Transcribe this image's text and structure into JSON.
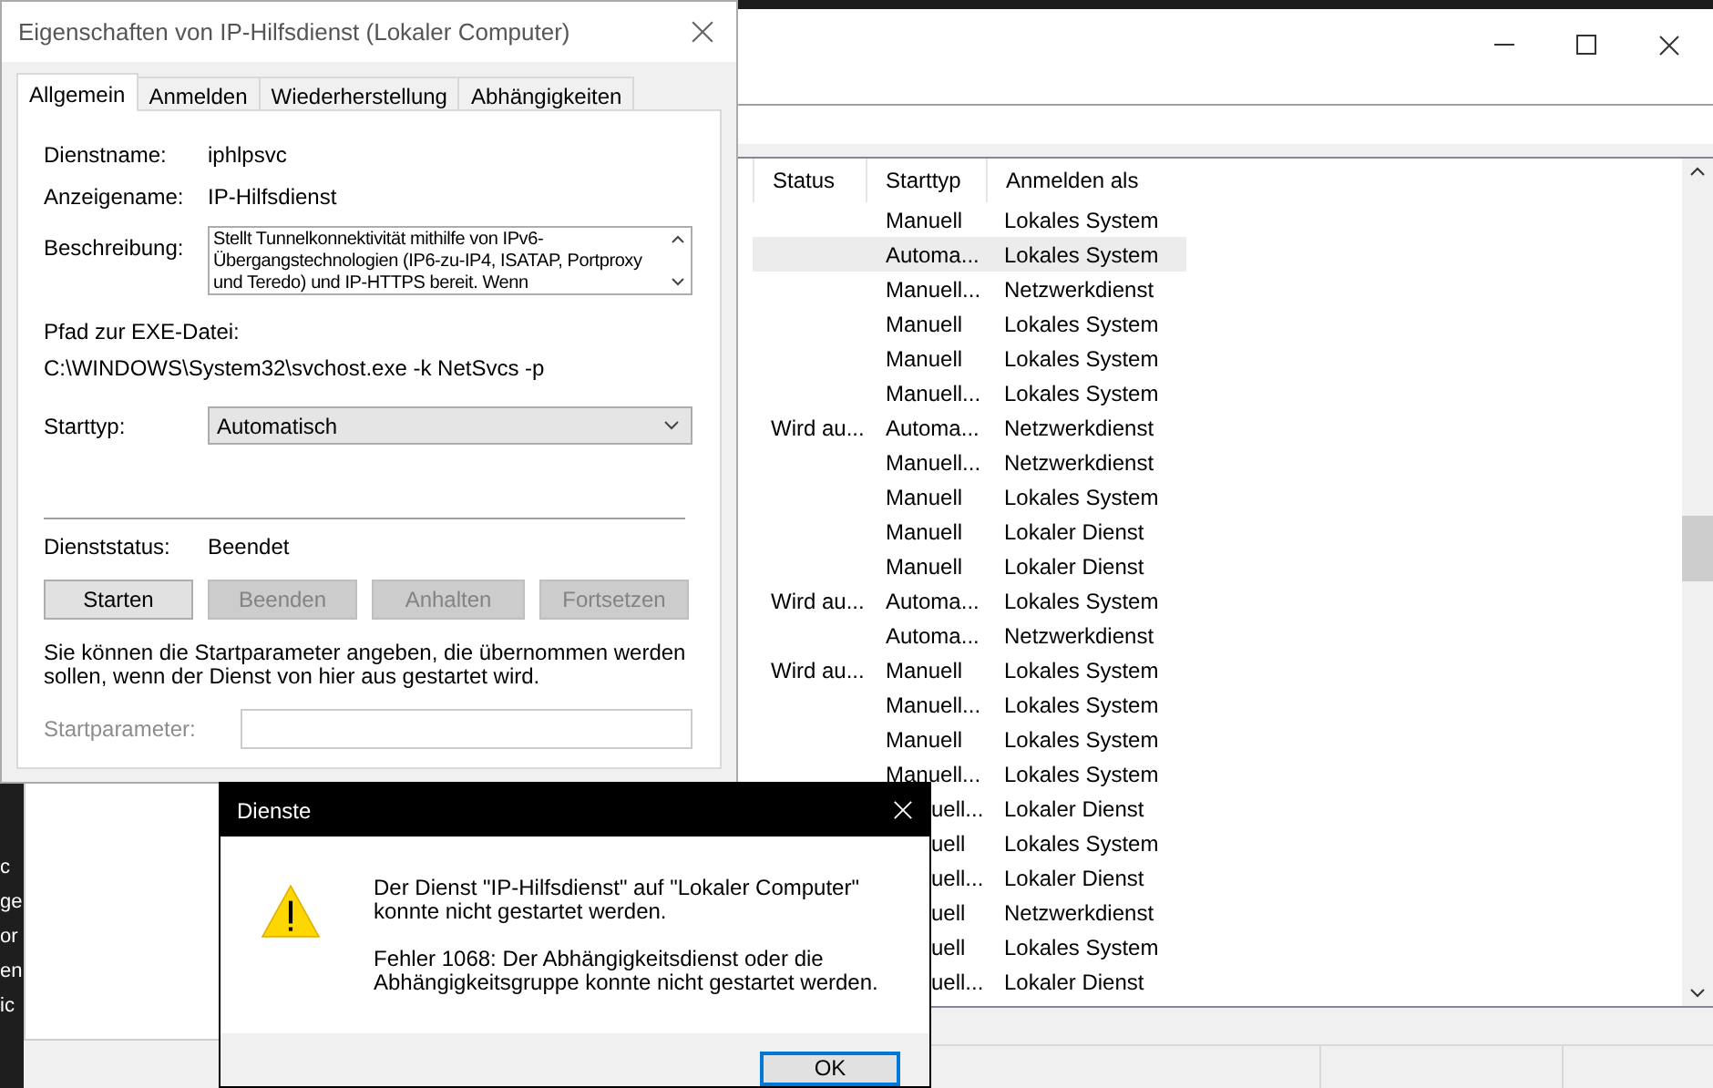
{
  "background_text": [
    "c",
    "ge",
    "or",
    "en",
    "ic"
  ],
  "services_window": {
    "columns": [
      "Status",
      "Starttyp",
      "Anmelden als"
    ],
    "rows": [
      {
        "status": "",
        "starttyp": "Manuell",
        "anmelden_als": "Lokales System",
        "selected": false
      },
      {
        "status": "",
        "starttyp": "Automa...",
        "anmelden_als": "Lokales System",
        "selected": true
      },
      {
        "status": "",
        "starttyp": "Manuell...",
        "anmelden_als": "Netzwerkdienst",
        "selected": false
      },
      {
        "status": "",
        "starttyp": "Manuell",
        "anmelden_als": "Lokales System",
        "selected": false
      },
      {
        "status": "",
        "starttyp": "Manuell",
        "anmelden_als": "Lokales System",
        "selected": false
      },
      {
        "status": "",
        "starttyp": "Manuell...",
        "anmelden_als": "Lokales System",
        "selected": false
      },
      {
        "status": "Wird au...",
        "starttyp": "Automa...",
        "anmelden_als": "Netzwerkdienst",
        "selected": false
      },
      {
        "status": "",
        "starttyp": "Manuell...",
        "anmelden_als": "Netzwerkdienst",
        "selected": false
      },
      {
        "status": "",
        "starttyp": "Manuell",
        "anmelden_als": "Lokales System",
        "selected": false
      },
      {
        "status": "",
        "starttyp": "Manuell",
        "anmelden_als": "Lokaler Dienst",
        "selected": false
      },
      {
        "status": "",
        "starttyp": "Manuell",
        "anmelden_als": "Lokaler Dienst",
        "selected": false
      },
      {
        "status": "Wird au...",
        "starttyp": "Automa...",
        "anmelden_als": "Lokales System",
        "selected": false
      },
      {
        "status": "",
        "starttyp": "Automa...",
        "anmelden_als": "Netzwerkdienst",
        "selected": false
      },
      {
        "status": "Wird au...",
        "starttyp": "Manuell",
        "anmelden_als": "Lokales System",
        "selected": false
      },
      {
        "status": "",
        "starttyp": "Manuell...",
        "anmelden_als": "Lokales System",
        "selected": false
      },
      {
        "status": "",
        "starttyp": "Manuell",
        "anmelden_als": "Lokales System",
        "selected": false
      },
      {
        "status": "",
        "starttyp": "Manuell...",
        "anmelden_als": "Lokales System",
        "selected": false
      },
      {
        "status": "",
        "starttyp": "uell...",
        "anmelden_als": "Lokaler Dienst",
        "selected": false
      },
      {
        "status": "",
        "starttyp": "uell",
        "anmelden_als": "Lokales System",
        "selected": false
      },
      {
        "status": "",
        "starttyp": "uell...",
        "anmelden_als": "Lokaler Dienst",
        "selected": false
      },
      {
        "status": "",
        "starttyp": "uell",
        "anmelden_als": "Netzwerkdienst",
        "selected": false
      },
      {
        "status": "",
        "starttyp": "uell",
        "anmelden_als": "Lokales System",
        "selected": false
      },
      {
        "status": "",
        "starttyp": "uell...",
        "anmelden_als": "Lokaler Dienst",
        "selected": false
      }
    ]
  },
  "properties_dialog": {
    "title": "Eigenschaften von IP-Hilfsdienst (Lokaler Computer)",
    "tabs": [
      {
        "label": "Allgemein",
        "selected": true
      },
      {
        "label": "Anmelden",
        "selected": false
      },
      {
        "label": "Wiederherstellung",
        "selected": false
      },
      {
        "label": "Abhängigkeiten",
        "selected": false
      }
    ],
    "dienstname_label": "Dienstname:",
    "dienstname": "iphlpsvc",
    "anzeigename_label": "Anzeigename:",
    "anzeigename": "IP-Hilfsdienst",
    "beschreibung_label": "Beschreibung:",
    "beschreibung": "Stellt Tunnelkonnektivität mithilfe von IPv6-Übergangstechnologien (IP6-zu-IP4, ISATAP, Portproxy und Teredo) und IP-HTTPS bereit. Wenn",
    "pfad_label": "Pfad zur EXE-Datei:",
    "pfad": "C:\\WINDOWS\\System32\\svchost.exe -k NetSvcs -p",
    "starttyp_label": "Starttyp:",
    "starttyp": "Automatisch",
    "dienststatus_label": "Dienststatus:",
    "dienststatus": "Beendet",
    "buttons": [
      {
        "label": "Starten",
        "disabled": false
      },
      {
        "label": "Beenden",
        "disabled": true
      },
      {
        "label": "Anhalten",
        "disabled": true
      },
      {
        "label": "Fortsetzen",
        "disabled": true
      }
    ],
    "hint": "Sie können die Startparameter angeben, die übernommen werden sollen, wenn der Dienst von hier aus gestartet wird.",
    "startparameter_label": "Startparameter:",
    "startparameter_disabled": true
  },
  "error_dialog": {
    "title": "Dienste",
    "message": "Der Dienst \"IP-Hilfsdienst\" auf \"Lokaler Computer\" konnte nicht gestartet werden.",
    "detail": "Fehler 1068: Der Abhängigkeitsdienst oder die Abhängigkeitsgruppe konnte nicht gestartet werden.",
    "ok": "OK"
  }
}
